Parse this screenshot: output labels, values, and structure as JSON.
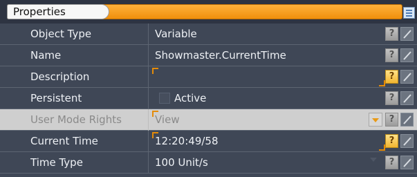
{
  "header": {
    "tab_label": "Properties"
  },
  "rows": [
    {
      "label": "Object Type",
      "value": "Variable"
    },
    {
      "label": "Name",
      "value": "Showmaster.CurrentTime"
    },
    {
      "label": "Description",
      "value": ""
    },
    {
      "label": "Persistent",
      "value": "Active"
    },
    {
      "label": "User Mode Rights",
      "value": "View"
    },
    {
      "label": "Current Time",
      "value": "12:20:49/58"
    },
    {
      "label": "Time Type",
      "value": "100 Unit/s"
    }
  ],
  "buttons": {
    "help_symbol": "?"
  },
  "colors": {
    "accent": "#f29a17",
    "panel": "#3f4756",
    "disabled_row": "#cfcfcf"
  }
}
